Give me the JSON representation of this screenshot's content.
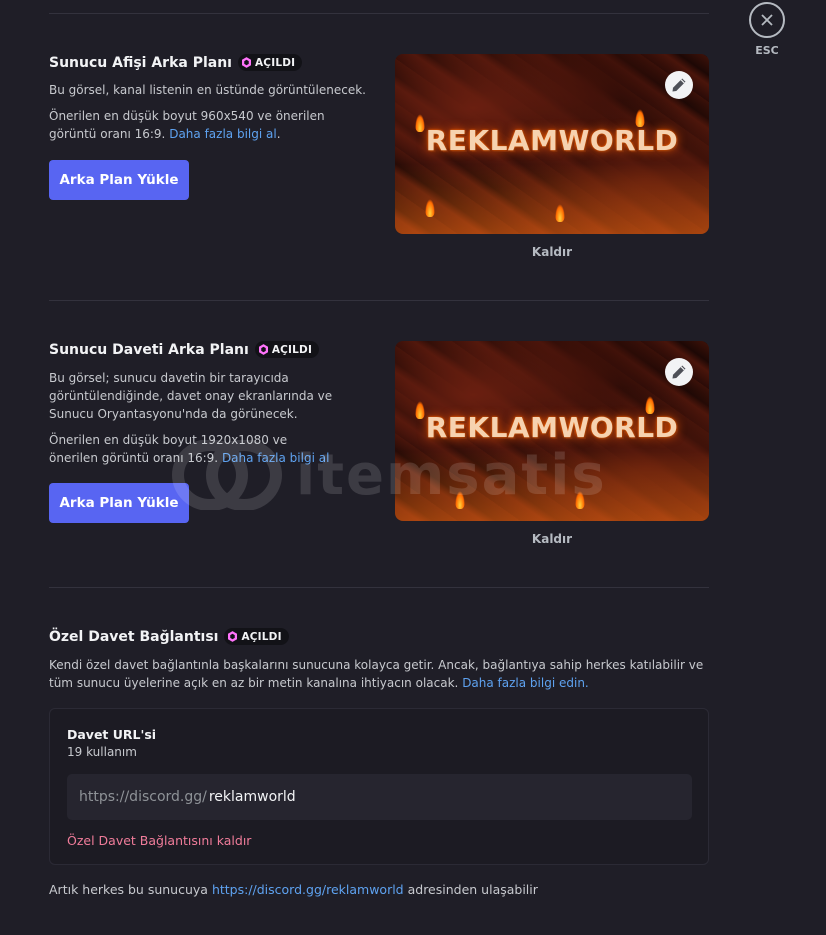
{
  "close": {
    "esc_label": "ESC"
  },
  "banner_section": {
    "title": "Sunucu Afişi Arka Planı",
    "badge": "AÇILDI",
    "desc_1": "Bu görsel, kanal listenin en üstünde görüntülenecek.",
    "desc_2": "Önerilen en düşük boyut 960x540 ve önerilen görüntü oranı 16:9.",
    "learn_more": "Daha fazla bilgi al",
    "after_link": ".",
    "upload_button": "Arka Plan Yükle",
    "image_text": "REKLAMWORLD",
    "remove_label": "Kaldır"
  },
  "invite_bg_section": {
    "title": "Sunucu Daveti Arka Planı",
    "badge": "AÇILDI",
    "desc_1": "Bu görsel; sunucu davetin bir tarayıcıda görüntülendiğinde, davet onay ekranlarında ve Sunucu Oryantasyonu'nda da görünecek.",
    "desc_2": "Önerilen en düşük boyut 1920x1080 ve önerilen görüntü oranı 16:9.",
    "learn_more": "Daha fazla bilgi al",
    "upload_button": "Arka Plan Yükle",
    "image_text": "REKLAMWORLD",
    "remove_label": "Kaldır"
  },
  "vanity_section": {
    "title": "Özel Davet Bağlantısı",
    "badge": "AÇILDI",
    "desc": "Kendi özel davet bağlantınla başkalarını sunucuna kolayca getir. Ancak, bağlantıya sahip herkes katılabilir ve tüm sunucu üyelerine açık en az bir metin kanalına ihtiyacın olacak.",
    "learn_more": "Daha fazla bilgi edin.",
    "box": {
      "label": "Davet URL'si",
      "usage": "19 kullanım",
      "prefix": "https://discord.gg/",
      "value": "reklamworld",
      "remove_link": "Özel Davet Bağlantısını kaldır"
    },
    "footer_before": "Artık herkes bu sunucuya ",
    "footer_link": "https://discord.gg/reklamworld",
    "footer_after": " adresinden ulaşabilir"
  },
  "watermark": {
    "text": "itemsatis"
  },
  "colors": {
    "accent": "#5865f2",
    "link": "#5ea2f0",
    "danger": "#f07c9a",
    "background": "#1f1e27"
  }
}
